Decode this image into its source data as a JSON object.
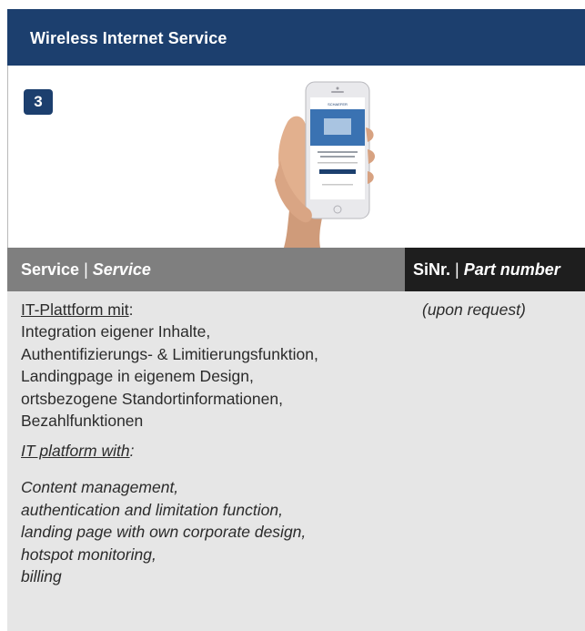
{
  "header": {
    "title": "Wireless Internet Service"
  },
  "badge": {
    "step": "3"
  },
  "phone_screen": {
    "logo_text": "SCHAEFER"
  },
  "table_header": {
    "service_de": "Service",
    "separator": "|",
    "service_en": "Service",
    "part_de": "SiNr.",
    "part_en": "Part number"
  },
  "service": {
    "de_heading": "IT-Plattform mit",
    "de_colon": ":",
    "de_lines": [
      "Integration eigener Inhalte,",
      "Authentifizierungs- & Limitierungsfunktion,",
      "Landingpage in eigenem Design,",
      "ortsbezogene Standortinformationen,",
      "Bezahlfunktionen"
    ],
    "en_heading": "IT platform with",
    "en_colon": ":",
    "en_lines": [
      "Content management,",
      "authentication and limitation function,",
      "landing page with own corporate design,",
      "hotspot monitoring,",
      "billing"
    ]
  },
  "part_number": {
    "value": "(upon request)"
  },
  "colors": {
    "header_blue": "#1c3f6e",
    "service_header_gray": "#7f7f7f",
    "part_header_dark": "#1e1e1e",
    "content_bg": "#e6e6e6"
  }
}
